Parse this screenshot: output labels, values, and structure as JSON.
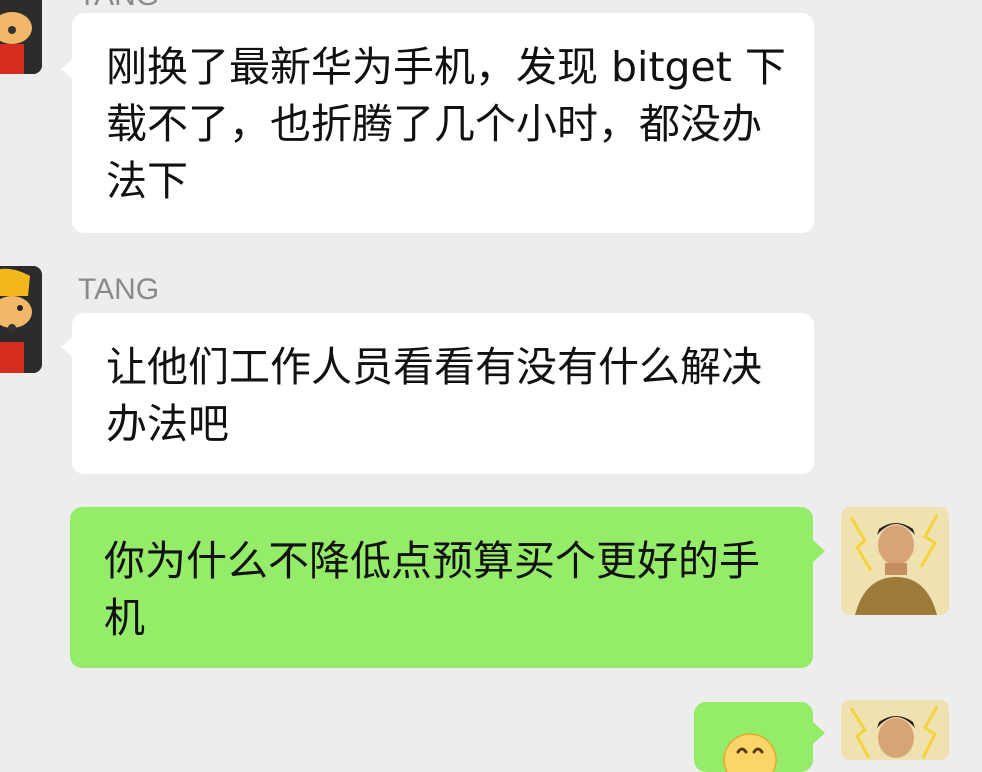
{
  "messages": [
    {
      "direction": "incoming",
      "sender": "TANG",
      "text": "刚换了最新华为手机，发现 bitget 下载不了，也折腾了几个小时，都没办法下"
    },
    {
      "direction": "incoming",
      "sender": "TANG",
      "text": "让他们工作人员看看有没有什么解决办法吧"
    },
    {
      "direction": "outgoing",
      "text": "你为什么不降低点预算买个更好的手机"
    },
    {
      "direction": "outgoing",
      "emoji": "smiling-face-emoji"
    }
  ],
  "colors": {
    "background": "#ededed",
    "incoming_bubble": "#ffffff",
    "outgoing_bubble": "#95ec69",
    "sender_name": "#8a8a8a",
    "text": "#111111"
  }
}
